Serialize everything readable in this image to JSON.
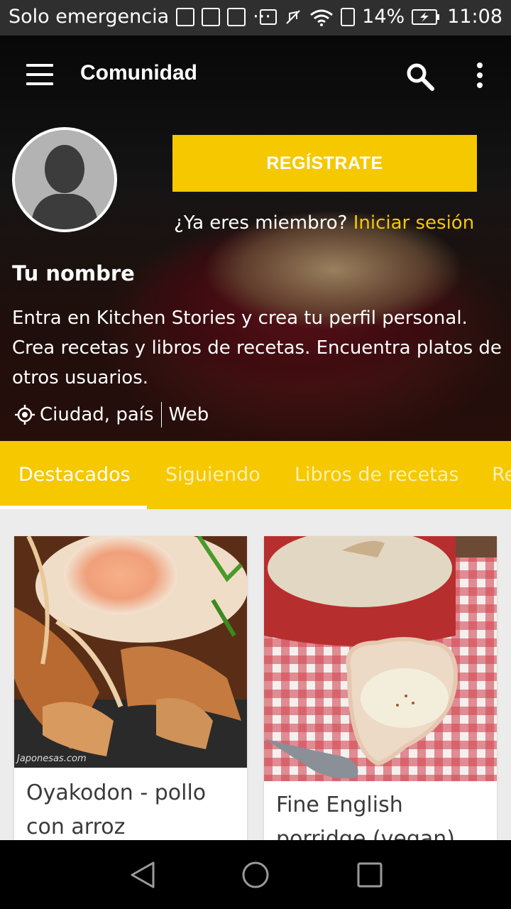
{
  "status": {
    "carrier": "Solo emergencia",
    "battery": "14%",
    "time": "11:08",
    "icons": [
      "screenshot-icon",
      "image-icon",
      "mail-icon",
      "more-dots-icon",
      "nfc-icon",
      "mute-icon",
      "wifi-icon",
      "sim-icon",
      "battery-charging-icon"
    ]
  },
  "toolbar": {
    "title": "Comunidad"
  },
  "profile": {
    "register_label": "REGÍSTRATE",
    "member_question": "¿Ya eres miembro?",
    "login_label": "Iniciar sesión",
    "name": "Tu nombre",
    "description": "Entra en Kitchen Stories y crea tu perfil personal. Crea recetas y libros de recetas. Encuentra platos de otros usuarios.",
    "location": "Ciudad, país",
    "web": "Web"
  },
  "tabs": [
    {
      "label": "Destacados",
      "active": true
    },
    {
      "label": "Siguiendo",
      "active": false
    },
    {
      "label": "Libros de recetas",
      "active": false
    },
    {
      "label": "Re",
      "active": false
    }
  ],
  "cards": [
    {
      "title": "Oyakodon - pollo con arroz",
      "watermark": "Japonesas.com"
    },
    {
      "title": "Fine English porridge (vegan)"
    }
  ],
  "colors": {
    "accent": "#f5c800",
    "statusbar": "#2f2f2f",
    "navbar": "#000000",
    "background": "#ececec"
  }
}
